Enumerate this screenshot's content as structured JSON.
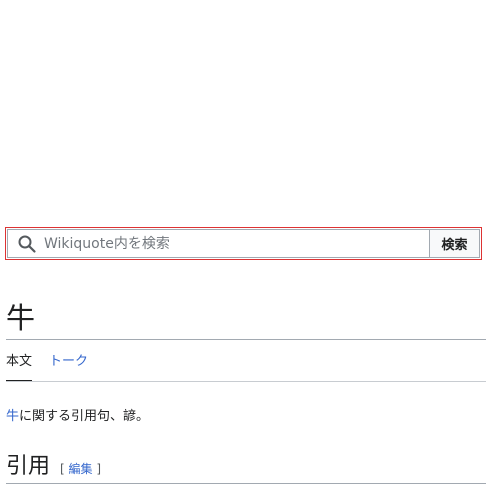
{
  "search": {
    "placeholder": "Wikiquote内を検索",
    "button_label": "検索"
  },
  "article": {
    "title": "牛",
    "tabs": [
      {
        "label": "本文",
        "selected": true
      },
      {
        "label": "トーク",
        "selected": false
      }
    ],
    "intro": {
      "link_text": "牛",
      "rest_text": "に関する引用句、諺。"
    },
    "section": {
      "title": "引用",
      "edit_open": "[",
      "edit_label": "編集",
      "edit_close": "]"
    }
  },
  "colors": {
    "link": "#3366cc",
    "text": "#202122",
    "search_focus_border": "#dd3333"
  },
  "icons": {
    "search": "search-icon"
  }
}
